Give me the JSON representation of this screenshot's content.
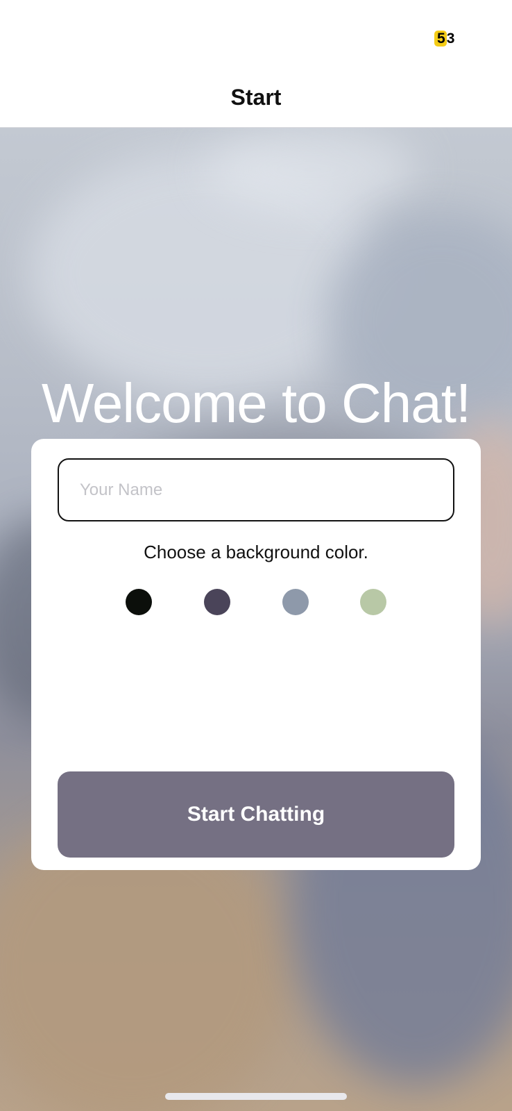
{
  "status_bar": {
    "battery_level": "53",
    "battery_highlight": "5",
    "battery_rest": "3"
  },
  "nav": {
    "title": "Start"
  },
  "welcome": {
    "title": "Welcome to Chat!"
  },
  "form": {
    "name_placeholder": "Your Name",
    "name_value": "",
    "color_prompt": "Choose a background color.",
    "colors": [
      "#0c0f0b",
      "#4a4459",
      "#8e99aa",
      "#b8c8a6"
    ],
    "start_button_label": "Start Chatting",
    "start_button_color": "#757083"
  },
  "theme": {
    "battery_badge": "#f4cc16",
    "card_background": "#ffffff"
  }
}
